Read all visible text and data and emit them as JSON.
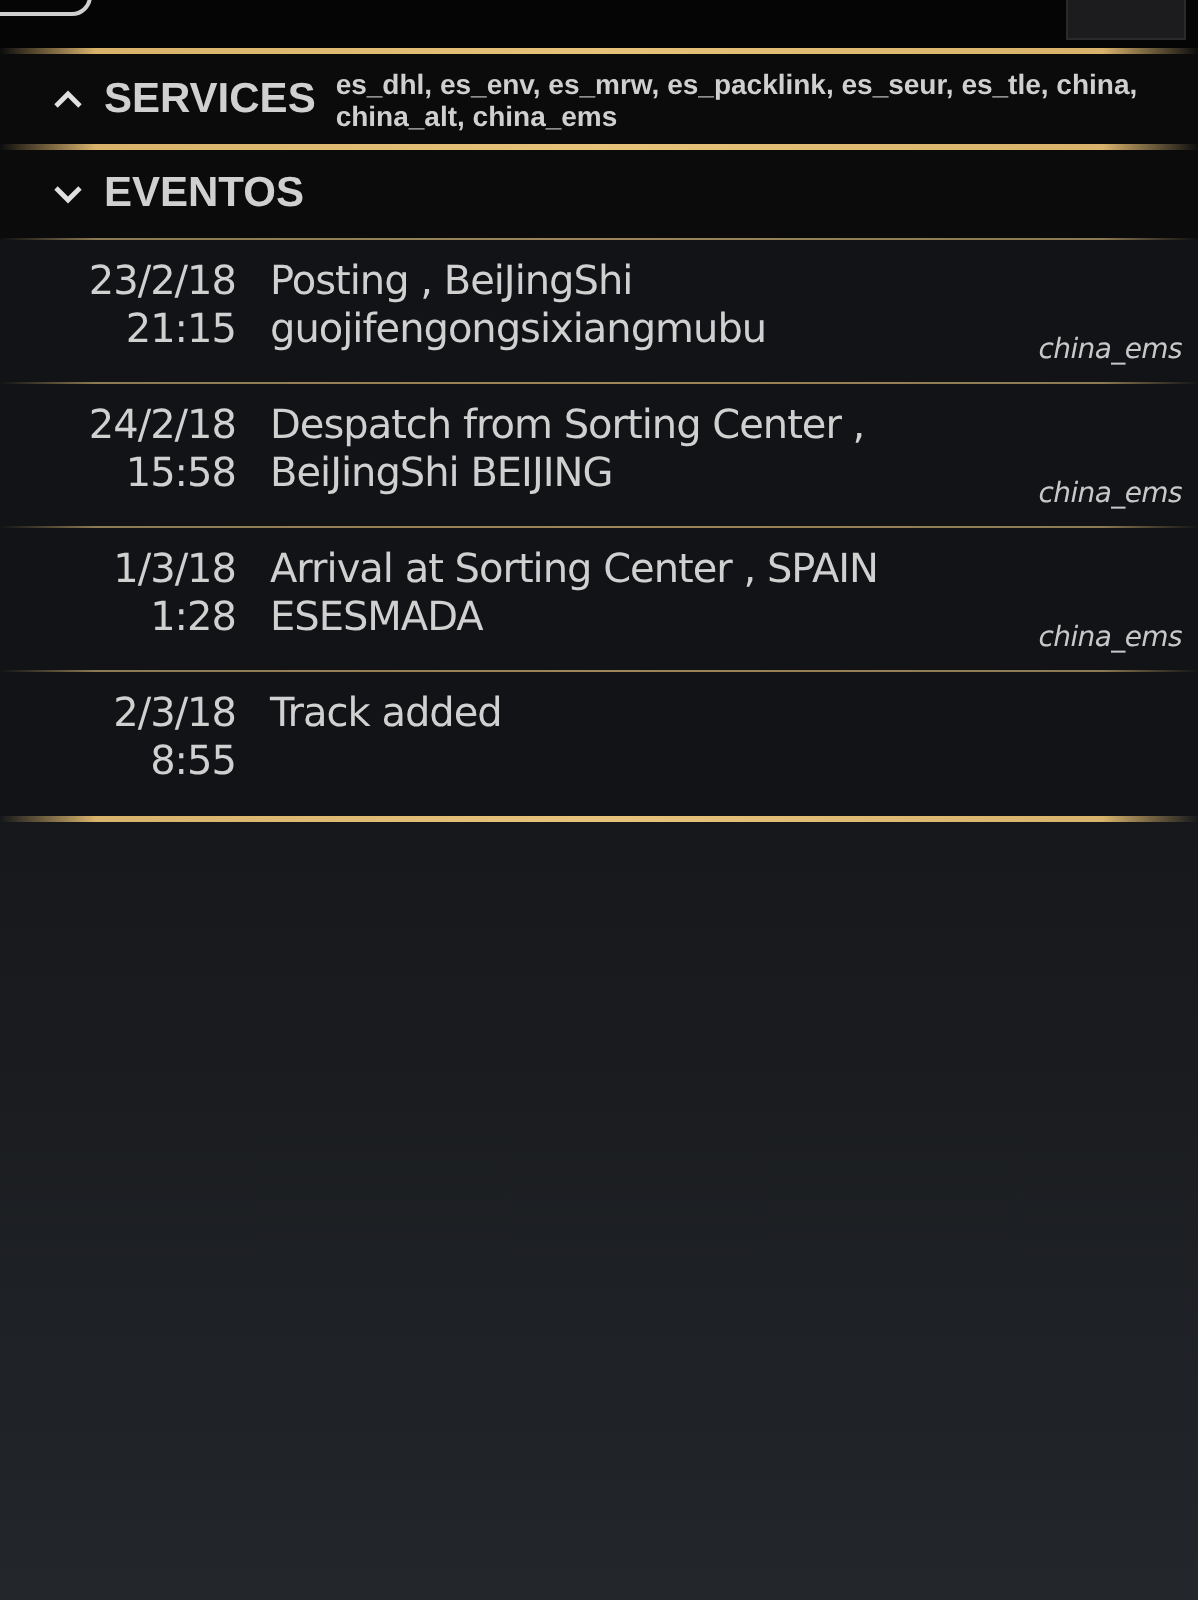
{
  "services": {
    "title": "SERVICES",
    "expanded": false,
    "list": "es_dhl, es_env, es_mrw, es_packlink, es_seur, es_tle, china, china_alt, china_ems"
  },
  "eventos": {
    "title": "EVENTOS",
    "expanded": true,
    "events": [
      {
        "date": "23/2/18",
        "time": "21:15",
        "description": "Posting , BeiJingShi guojifengongsixiangmubu",
        "service": "china_ems"
      },
      {
        "date": "24/2/18",
        "time": "15:58",
        "description": "Despatch from Sorting Center , BeiJingShi BEIJING",
        "service": "china_ems"
      },
      {
        "date": "1/3/18",
        "time": "1:28",
        "description": "Arrival at Sorting Center , SPAIN ESESMADA",
        "service": "china_ems"
      },
      {
        "date": "2/3/18",
        "time": "8:55",
        "description": "Track added"
      }
    ]
  }
}
